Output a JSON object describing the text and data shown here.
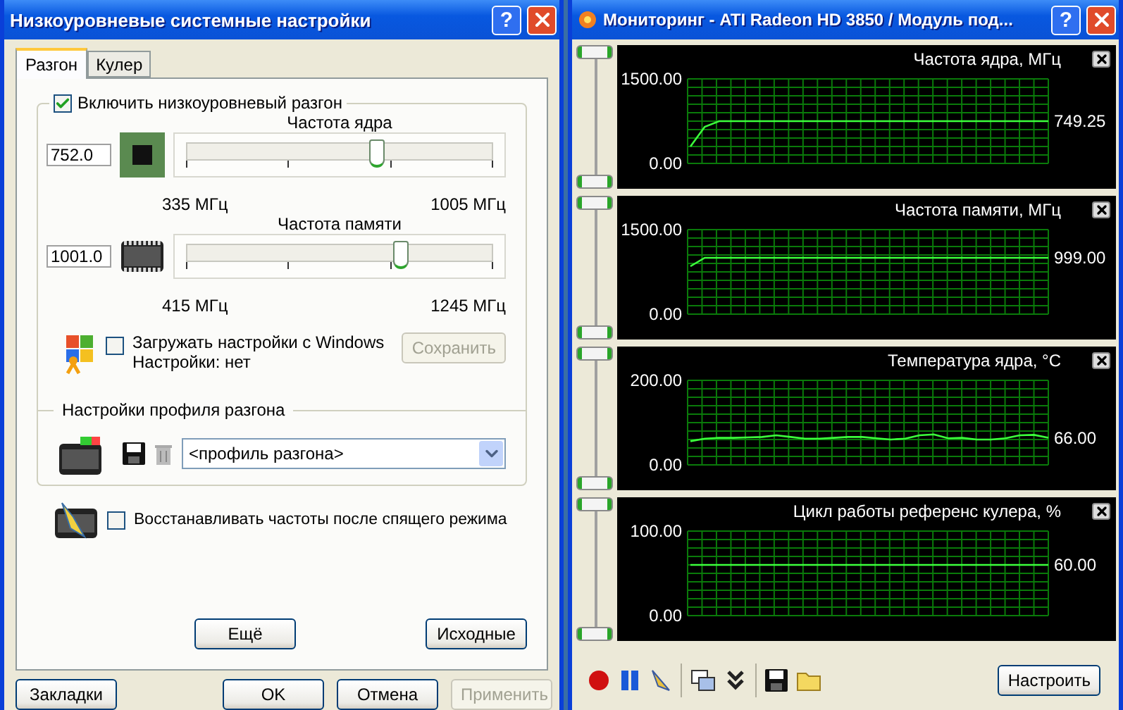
{
  "settings_window": {
    "title": "Низкоуровневые системные настройки",
    "help": "?",
    "tabs": [
      {
        "label": "Разгон",
        "selected": true
      },
      {
        "label": "Кулер",
        "selected": false
      }
    ],
    "overclock": {
      "label": "Включить низкоуровневый разгон",
      "checked": true,
      "sliders": [
        {
          "kind": "chip",
          "title": "Частота ядра",
          "value": "752.0",
          "level": 0.62,
          "min": "335 МГц",
          "max": "1005 МГц"
        },
        {
          "kind": "memory",
          "title": "Частота памяти",
          "value": "1001.0",
          "level": 0.7,
          "min": "415 МГц",
          "max": "1245 МГц"
        }
      ],
      "load_with_windows": {
        "label": "Загружать настройки с Windows",
        "checked": false,
        "status": "Настройки: нет"
      },
      "save_button": {
        "label": "Сохранить",
        "disabled": true
      },
      "profile": {
        "title": "Настройки профиля разгона",
        "value": "<профиль разгона>"
      }
    },
    "restore": {
      "label": "Восстанавливать частоты после спящего режима",
      "checked": false
    },
    "panel_buttons": [
      {
        "label": "Ещё"
      },
      {
        "label": "Исходные"
      }
    ],
    "buttons": [
      {
        "label": "Закладки",
        "disabled": false
      },
      {
        "label": "OK",
        "disabled": false
      },
      {
        "label": "Отмена",
        "disabled": false
      },
      {
        "label": "Применить",
        "disabled": true
      }
    ]
  },
  "monitor_window": {
    "title": "Мониторинг - ATI Radeon HD 3850 / Модуль под...",
    "help": "?",
    "graphs": [
      {
        "reading": "749.25",
        "chart_data": {
          "type": "line",
          "title": "Частота ядра, МГц",
          "ylim": [
            0,
            1500
          ],
          "yticks": [
            {
              "value": 0,
              "label": "0.00"
            },
            {
              "value": 1500,
              "label": "1500.00"
            }
          ],
          "grid": true,
          "values": [
            300,
            650,
            750,
            750,
            750,
            750,
            750,
            750,
            750,
            750,
            750,
            750,
            750,
            750,
            750,
            750,
            750,
            750,
            750,
            750,
            750,
            750,
            750,
            750,
            750,
            750
          ]
        }
      },
      {
        "reading": "999.00",
        "chart_data": {
          "type": "line",
          "title": "Частота памяти, МГц",
          "ylim": [
            0,
            1500
          ],
          "yticks": [
            {
              "value": 0,
              "label": "0.00"
            },
            {
              "value": 1500,
              "label": "1500.00"
            }
          ],
          "grid": true,
          "values": [
            850,
            1000,
            1000,
            1000,
            1000,
            1000,
            1000,
            1000,
            1000,
            1000,
            1000,
            1000,
            1000,
            1000,
            1000,
            1000,
            1000,
            1000,
            1000,
            1000,
            1000,
            1000,
            1000,
            1000,
            1000,
            1000
          ]
        }
      },
      {
        "reading": "66.00",
        "chart_data": {
          "type": "line",
          "title": "Температура ядра, °C",
          "ylim": [
            0,
            200
          ],
          "yticks": [
            {
              "value": 0,
              "label": "0.00"
            },
            {
              "value": 200,
              "label": "200.00"
            }
          ],
          "grid": true,
          "values": [
            56,
            62,
            64,
            64,
            65,
            66,
            70,
            66,
            62,
            62,
            64,
            66,
            66,
            63,
            60,
            62,
            70,
            72,
            63,
            64,
            60,
            60,
            63,
            70,
            71,
            64
          ]
        }
      },
      {
        "reading": "60.00",
        "chart_data": {
          "type": "line",
          "title": "Цикл работы референс кулера, %",
          "ylim": [
            0,
            100
          ],
          "yticks": [
            {
              "value": 0,
              "label": "0.00"
            },
            {
              "value": 100,
              "label": "100.00"
            }
          ],
          "grid": true,
          "values": [
            60,
            60,
            60,
            60,
            60,
            60,
            60,
            60,
            60,
            60,
            60,
            60,
            60,
            60,
            60,
            60,
            60,
            60,
            60,
            60,
            60,
            60,
            60,
            60,
            60,
            60
          ]
        }
      }
    ],
    "configure_button": "Настроить"
  }
}
